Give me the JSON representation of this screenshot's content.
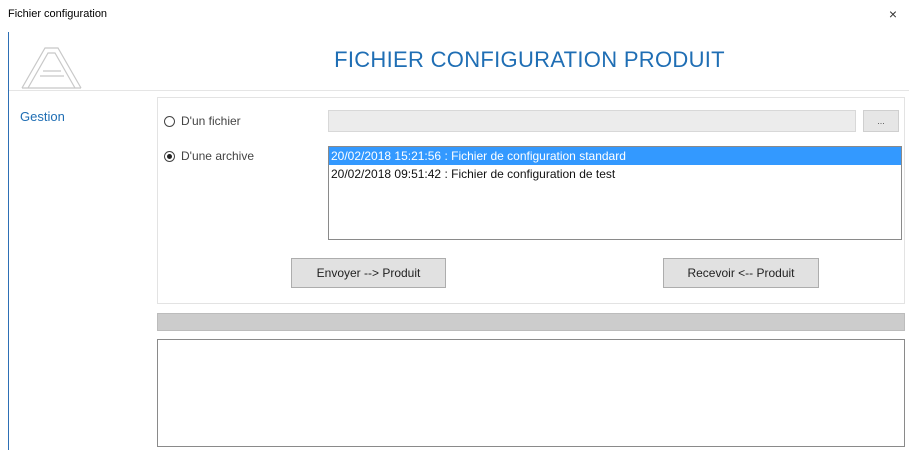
{
  "window": {
    "title": "Fichier configuration",
    "close_glyph": "×"
  },
  "header": {
    "title": "FICHIER CONFIGURATION PRODUIT"
  },
  "sidebar": {
    "items": [
      {
        "label": "Gestion"
      }
    ]
  },
  "source": {
    "from_file_label": "D'un fichier",
    "from_archive_label": "D'une archive",
    "selected": "archive",
    "file_path_value": "",
    "browse_label": "..."
  },
  "archives": [
    {
      "date": "20/02/2018 15:21:56",
      "sep": " : ",
      "description": "Fichier de configuration standard",
      "selected": true
    },
    {
      "date": "20/02/2018 09:51:42",
      "sep": " : ",
      "description": "Fichier de configuration de test",
      "selected": false
    }
  ],
  "actions": {
    "send_label": "Envoyer --> Produit",
    "receive_label": "Recevoir <-- Produit"
  },
  "progress": {
    "value": 0
  },
  "colors": {
    "accent": "#1f6eb4",
    "selection": "#3399ff"
  }
}
